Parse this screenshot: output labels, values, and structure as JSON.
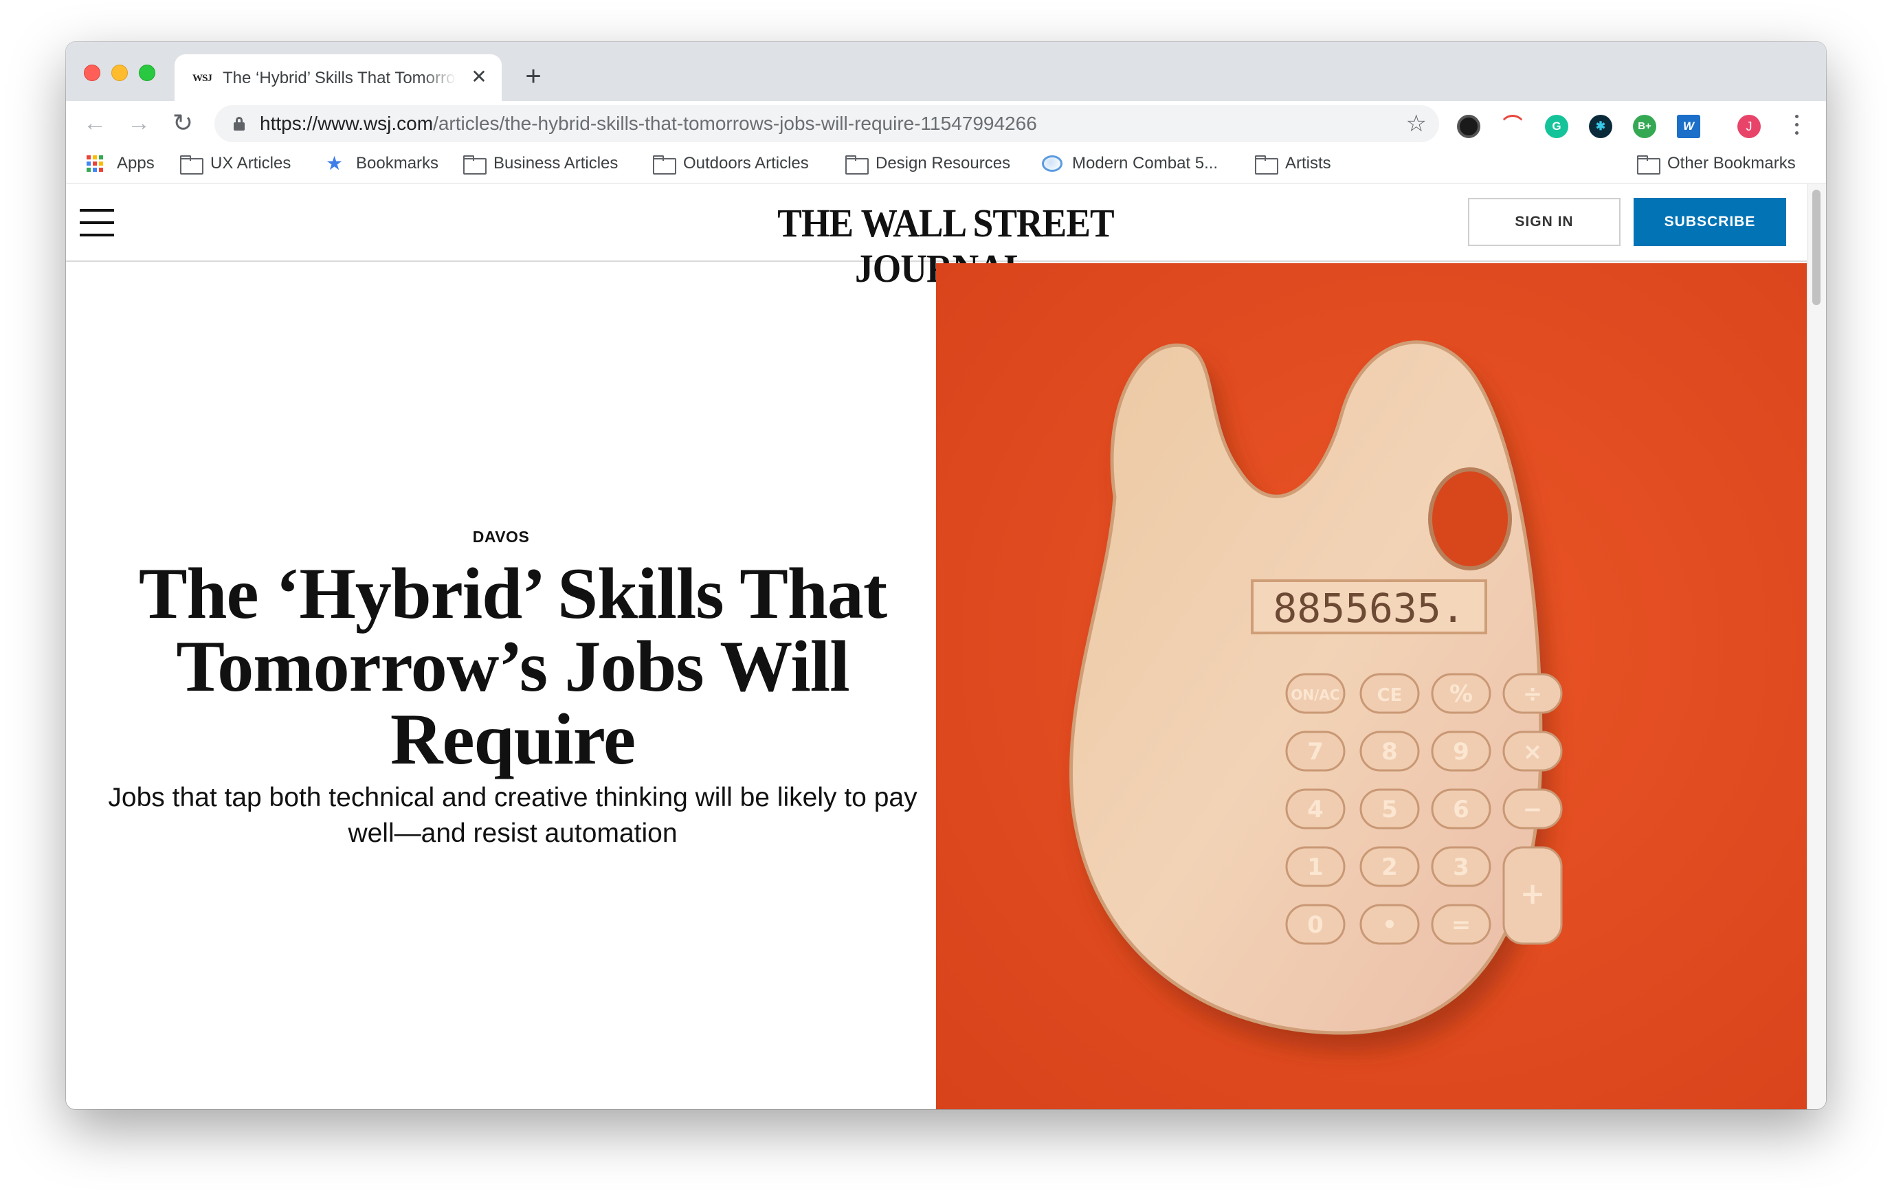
{
  "browser": {
    "tab": {
      "favicon_text": "WSJ",
      "title": "The ‘Hybrid’ Skills That Tomorrow’s Jobs Will Require",
      "close_symbol": "✕"
    },
    "new_tab_symbol": "+",
    "url": {
      "scheme_host": "https://www.wsj.com",
      "path": "/articles/the-hybrid-skills-that-tomorrows-jobs-will-require-11547994266"
    },
    "extensions": [
      "dark-eye-icon",
      "rainbow-arc-icon",
      "grammarly-icon",
      "bubble-icon",
      "B+",
      "W"
    ],
    "extension_labels": {
      "grammarly": "G",
      "bplus": "B+",
      "word": "W"
    },
    "profile_initial": "J",
    "colors": {
      "tabstrip": "#dee1e6",
      "close": "#ff5f57",
      "minimize": "#febc2e",
      "maximize": "#28c840"
    }
  },
  "bookmarks": {
    "items": [
      {
        "label": "Apps",
        "icon": "apps-grid-icon"
      },
      {
        "label": "UX Articles",
        "icon": "folder-icon"
      },
      {
        "label": "Bookmarks",
        "icon": "star-icon"
      },
      {
        "label": "Business Articles",
        "icon": "folder-icon"
      },
      {
        "label": "Outdoors Articles",
        "icon": "folder-icon"
      },
      {
        "label": "Design Resources",
        "icon": "folder-icon"
      },
      {
        "label": "Modern Combat 5...",
        "icon": "globe-icon"
      },
      {
        "label": "Artists",
        "icon": "folder-icon"
      }
    ],
    "other": "Other Bookmarks"
  },
  "site": {
    "logo": "THE WALL STREET JOURNAL.",
    "sign_in": "SIGN IN",
    "subscribe": "SUBSCRIBE",
    "accent": "#0274b6"
  },
  "article": {
    "section": "DAVOS",
    "headline": "The ‘Hybrid’ Skills That Tomorrow’s Jobs Will Require",
    "dek": "Jobs that tap both technical and creative thinking will be likely to pay well—and resist automation",
    "image": {
      "background": "#e24a1f",
      "display": "8855635.",
      "keys": [
        "ON/AC",
        "CE",
        "%",
        "÷",
        "7",
        "8",
        "9",
        "×",
        "4",
        "5",
        "6",
        "−",
        "1",
        "2",
        "3",
        "+",
        "0",
        "•",
        "="
      ]
    }
  }
}
